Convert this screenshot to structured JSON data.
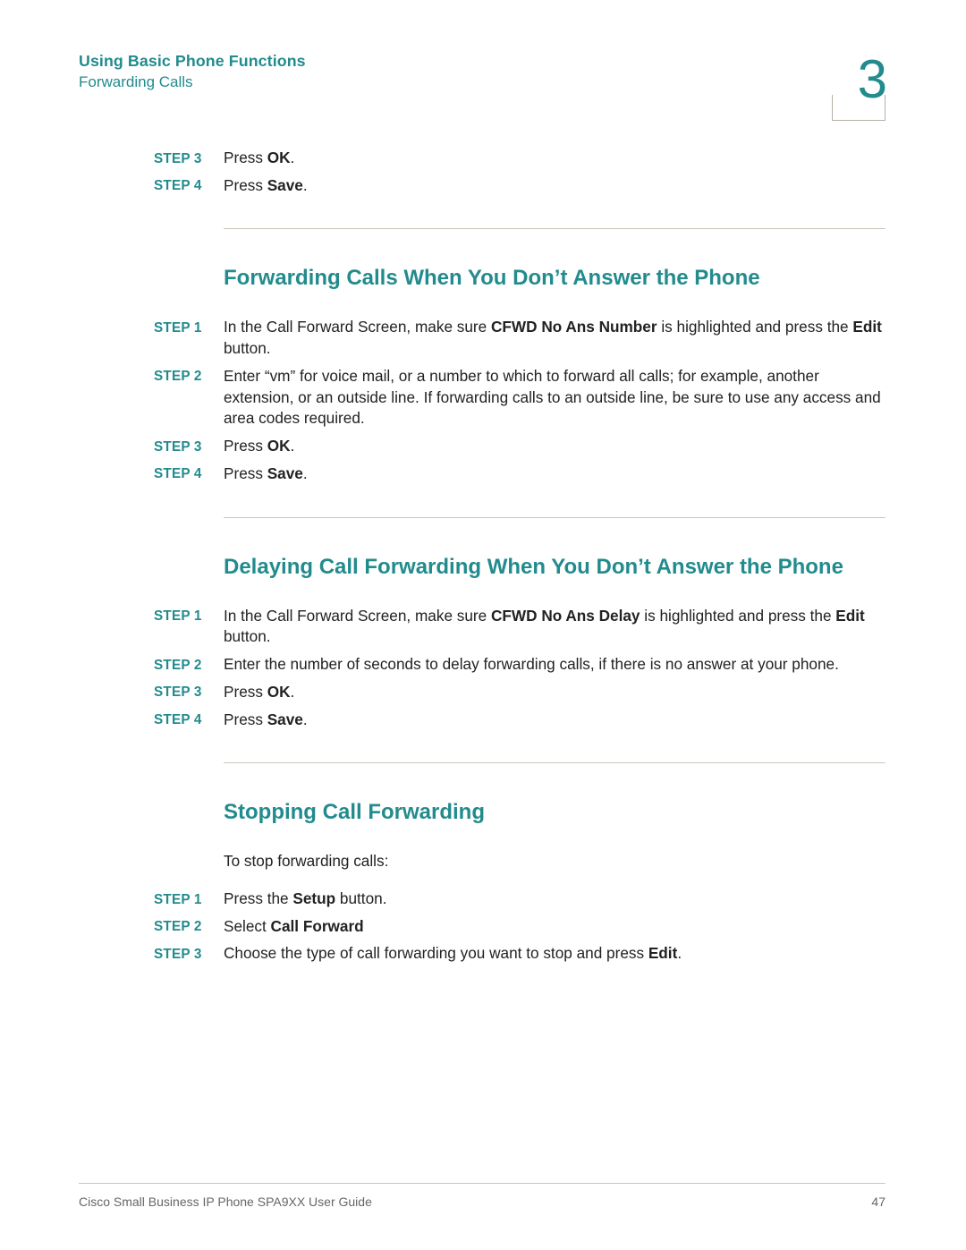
{
  "header": {
    "chapter_title": "Using Basic Phone Functions",
    "subtitle": "Forwarding Calls",
    "chapter_number": "3"
  },
  "continuation_steps": [
    {
      "label": "STEP  3",
      "html": "Press <b>OK</b>."
    },
    {
      "label": "STEP  4",
      "html": "Press <b>Save</b>."
    }
  ],
  "sections": [
    {
      "heading": "Forwarding Calls When You Don’t Answer the Phone",
      "intro": "",
      "steps": [
        {
          "label": "STEP  1",
          "html": "In the Call Forward Screen, make sure <b>CFWD No Ans Number</b> is highlighted and press the <b>Edit</b> button."
        },
        {
          "label": "STEP  2",
          "html": "Enter “vm” for voice mail, or a number to which to forward all calls; for example, another extension, or an outside line. If forwarding calls to an outside line, be sure to use any access and area codes required."
        },
        {
          "label": "STEP  3",
          "html": "Press <b>OK</b>."
        },
        {
          "label": "STEP  4",
          "html": "Press <b>Save</b>."
        }
      ]
    },
    {
      "heading": "Delaying Call Forwarding When You Don’t Answer the Phone",
      "intro": "",
      "steps": [
        {
          "label": "STEP  1",
          "html": "In the Call Forward Screen, make sure <b>CFWD No Ans Delay</b> is highlighted and press the <b>Edit</b> button."
        },
        {
          "label": "STEP  2",
          "html": "Enter the number of seconds to delay forwarding calls, if there is no answer at your phone."
        },
        {
          "label": "STEP  3",
          "html": "Press <b>OK</b>."
        },
        {
          "label": "STEP  4",
          "html": "Press <b>Save</b>."
        }
      ]
    },
    {
      "heading": "Stopping Call Forwarding",
      "intro": "To stop forwarding calls:",
      "steps": [
        {
          "label": "STEP  1",
          "html": "Press the <b>Setup</b> button."
        },
        {
          "label": "STEP  2",
          "html": "Select <b>Call Forward</b>"
        },
        {
          "label": "STEP  3",
          "html": "Choose the type of call forwarding you want to stop and press <b>Edit</b>."
        }
      ]
    }
  ],
  "footer": {
    "doc_title": "Cisco Small Business IP Phone SPA9XX User Guide",
    "page": "47"
  }
}
